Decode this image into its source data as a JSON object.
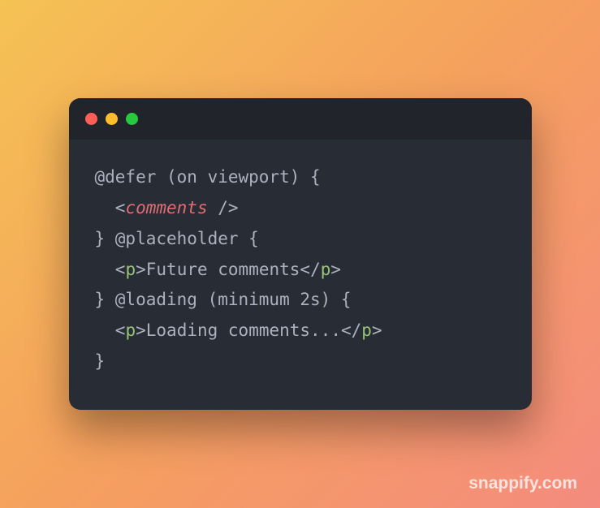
{
  "code": {
    "l1a": "@defer (on viewport) {",
    "l2a": "  ",
    "l2b": "<",
    "l2c": "comments ",
    "l2d": "/>",
    "l3a": "} @placeholder {",
    "l4a": "  ",
    "l4b": "<",
    "l4c": "p",
    "l4d": ">",
    "l4e": "Future comments",
    "l4f": "</",
    "l4g": "p",
    "l4h": ">",
    "l5a": "} @loading (minimum 2s) {",
    "l6a": "  ",
    "l6b": "<",
    "l6c": "p",
    "l6d": ">",
    "l6e": "Loading comments...",
    "l6f": "</",
    "l6g": "p",
    "l6h": ">",
    "l7a": "}"
  },
  "watermark": "snappify.com"
}
